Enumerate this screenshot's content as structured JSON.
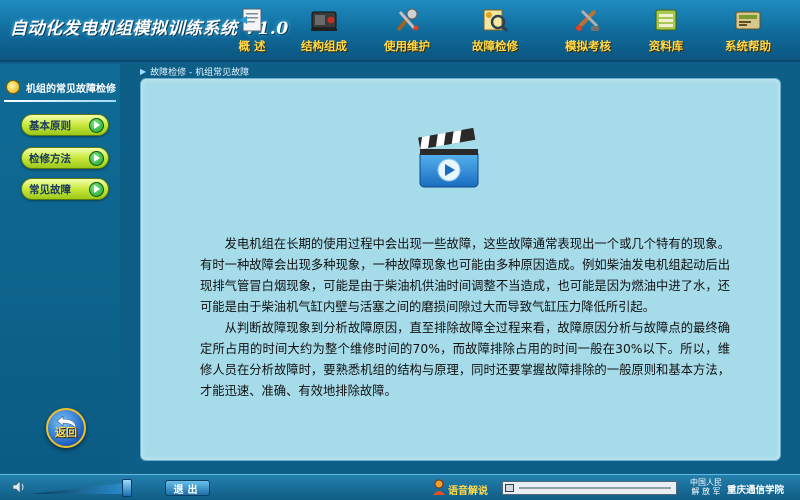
{
  "app": {
    "title": "自动化发电机组模拟训练系统 V1.0"
  },
  "nav": {
    "items": [
      {
        "label": "概 述",
        "icon": "document-icon"
      },
      {
        "label": "结构组成",
        "icon": "generator-icon"
      },
      {
        "label": "使用维护",
        "icon": "tools-icon"
      },
      {
        "label": "故障检修",
        "icon": "inspection-icon"
      },
      {
        "label": "模拟考核",
        "icon": "exam-icon"
      },
      {
        "label": "资料库",
        "icon": "database-icon"
      },
      {
        "label": "系统帮助",
        "icon": "help-icon"
      }
    ]
  },
  "sidebar": {
    "header": "机组的常见故障检修",
    "items": [
      {
        "label": "基本原则"
      },
      {
        "label": "检修方法"
      },
      {
        "label": "常见故障"
      }
    ],
    "back_label": "返回"
  },
  "breadcrumb": {
    "text": "故障检修 - 机组常见故障"
  },
  "content": {
    "paragraphs": [
      "发电机组在长期的使用过程中会出现一些故障，这些故障通常表现出一个或几个特有的现象。有时一种故障会出现多种现象，一种故障现象也可能由多种原因造成。例如柴油发电机组起动后出现排气管冒白烟现象，可能是由于柴油机供油时间调整不当造成，也可能是因为燃油中进了水，还可能是由于柴油机气缸内壁与活塞之间的磨损间隙过大而导致气缸压力降低所引起。",
      "从判断故障现象到分析故障原因，直至排除故障全过程来看，故障原因分析与故障点的最终确定所占用的时间大约为整个维修时间的70%，而故障排除占用的时间一般在30%以下。所以，维修人员在分析故障时，要熟悉机组的结构与原理，同时还要掌握故障排除的一般原则和基本方法，才能迅速、准确、有效地排除故障。"
    ]
  },
  "bottom": {
    "exit_label": "退出",
    "audio_label": "语音解说",
    "org_line1": "中国人民",
    "org_line2": "解 放 军",
    "org_name": "重庆通信学院"
  },
  "colors": {
    "accent_yellow": "#ffd94a",
    "content_bg": "#a6dbe9",
    "frame_bg": "#0d5f87"
  }
}
